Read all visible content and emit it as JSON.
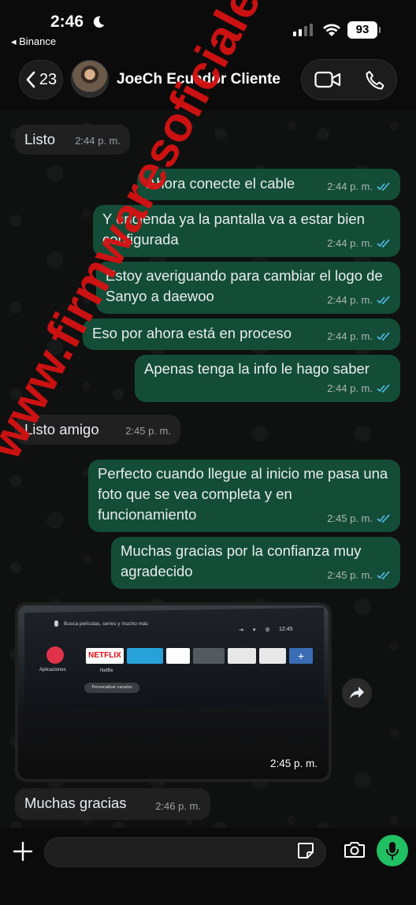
{
  "status_bar": {
    "time": "2:46",
    "back_app": "◂ Binance",
    "battery": "93"
  },
  "header": {
    "back_count": "23",
    "contact_name": "JoeCh Ecuador Cliente"
  },
  "messages": [
    {
      "dir": "in",
      "text": "Listo",
      "time": "2:44 p. m."
    },
    {
      "dir": "out",
      "text": "Ahora conecte el cable",
      "time": "2:44 p. m."
    },
    {
      "dir": "out",
      "text": "Y encienda ya la pantalla va a estar bien configurada",
      "time": "2:44 p. m."
    },
    {
      "dir": "out",
      "text": "Estoy averiguando para cambiar el logo de Sanyo a daewoo",
      "time": "2:44 p. m."
    },
    {
      "dir": "out",
      "text": "Eso por ahora está en proceso",
      "time": "2:44 p. m."
    },
    {
      "dir": "out",
      "text": "Apenas tenga la info le hago saber",
      "time": "2:44 p. m."
    },
    {
      "dir": "in",
      "text": "Listo amigo",
      "time": "2:45 p. m."
    },
    {
      "dir": "out",
      "text": "Perfecto cuando llegue al inicio me pasa una foto que se vea completa y en funcionamiento",
      "time": "2:45 p. m."
    },
    {
      "dir": "out",
      "text": "Muchas gracias por la confianza muy agradecido",
      "time": "2:45 p. m."
    },
    {
      "dir": "in",
      "text": "Muchas gracias",
      "time": "2:46 p. m."
    }
  ],
  "image_message": {
    "time": "2:45 p. m.",
    "tv": {
      "search_hint": "Busca películas, series y mucho más",
      "apps_label": "Aplicaciones",
      "netflix_tile": "NETFLIX",
      "netflix_label": "Netflix",
      "customize_button": "Personalizar canales",
      "clock": "12:45"
    }
  },
  "watermark": "www.firmwaresoficiales.net",
  "composer": {
    "placeholder": ""
  },
  "colors": {
    "outgoing_bubble": "#134d37",
    "incoming_bubble": "#202020",
    "mic_button": "#21c063",
    "read_ticks": "#53bdeb",
    "watermark": "#d61212"
  }
}
